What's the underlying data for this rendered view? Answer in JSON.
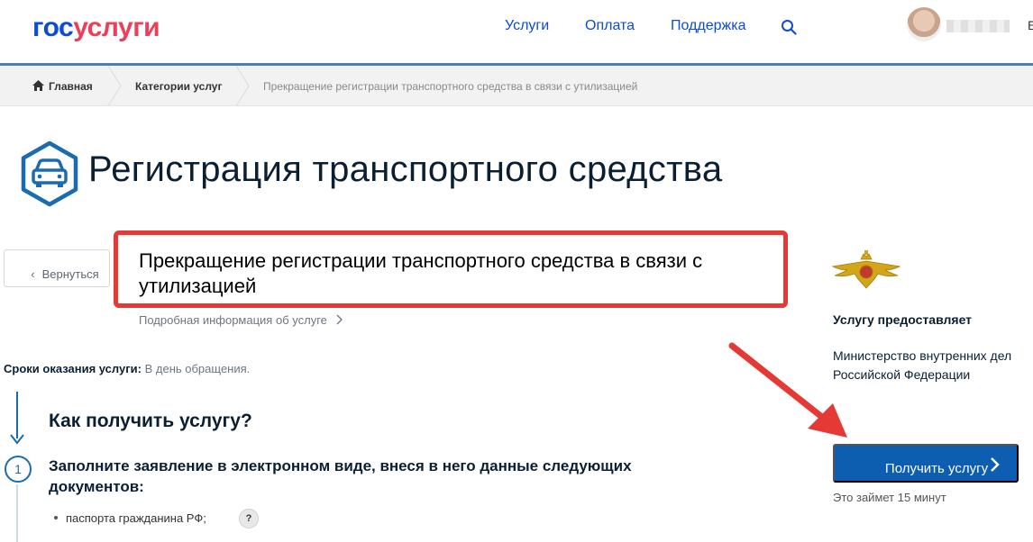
{
  "header": {
    "logo_gos": "гос",
    "logo_uslugi": "услуги",
    "nav": [
      "Услуги",
      "Оплата",
      "Поддержка"
    ],
    "user_initial": "Е"
  },
  "breadcrumb": {
    "home": "Главная",
    "category": "Категории услуг",
    "current": "Прекращение регистрации транспортного средства в связи с утилизацией"
  },
  "page": {
    "title": "Регистрация транспортного средства",
    "back_label": "Вернуться",
    "service_name": "Прекращение регистрации транспортного средства в связи с утилизацией",
    "details_link": "Подробная информация об услуге",
    "terms_label": "Сроки оказания услуги:",
    "terms_value": "В день обращения.",
    "how_title": "Как получить услугу?",
    "step_number": "1",
    "step_text": "Заполните заявление в электронном виде, внеся в него данные следующих документов:",
    "documents": [
      "паспорта гражданина РФ;"
    ],
    "help_mark": "?"
  },
  "sidebar": {
    "provider_label": "Услугу предоставляет",
    "provider_name": "Министерство внутренних дел Российской Федерации",
    "get_button": "Получить услугу",
    "time_note": "Это займет 15 минут"
  },
  "colors": {
    "brand_blue": "#0d4cd3",
    "brand_red": "#ee3f58",
    "button_blue": "#0d5db0",
    "highlight_red": "#e53935"
  }
}
